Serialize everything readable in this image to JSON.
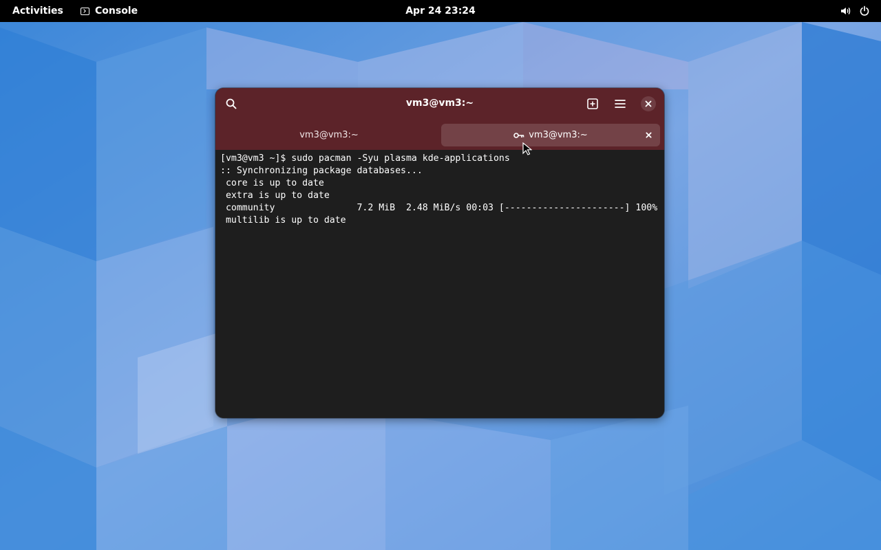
{
  "topbar": {
    "activities_label": "Activities",
    "app_name": "Console",
    "app_icon": "terminal-prompt-icon",
    "clock": "Apr 24  23:24",
    "tray_icons": [
      "volume-icon",
      "power-icon"
    ]
  },
  "window": {
    "title": "vm3@vm3:~",
    "header_icons": [
      "search-icon",
      "new-tab-icon",
      "menu-icon",
      "close-icon"
    ],
    "accent_color": "#5c2329",
    "tabs": [
      {
        "label": "vm3@vm3:~",
        "active": false
      },
      {
        "label": "vm3@vm3:~",
        "active": true,
        "icon": "key-icon"
      }
    ]
  },
  "terminal": {
    "lines": [
      "[vm3@vm3 ~]$ sudo pacman -Syu plasma kde-applications",
      ":: Synchronizing package databases...",
      " core is up to date",
      " extra is up to date",
      " community               7.2 MiB  2.48 MiB/s 00:03 [----------------------] 100%",
      " multilib is up to date"
    ]
  }
}
